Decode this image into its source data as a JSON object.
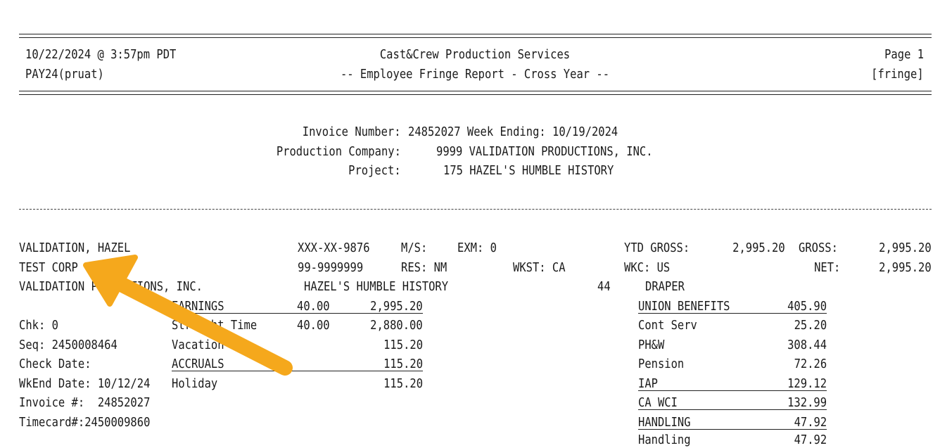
{
  "header": {
    "datetime": "10/22/2024 @ 3:57pm PDT",
    "user": "PAY24(pruat)",
    "company": "Cast&Crew Production Services",
    "report_title": "-- Employee Fringe Report - Cross Year --",
    "page": "Page 1",
    "code": "[fringe]"
  },
  "invoice": {
    "invoice_label": "Invoice Number:",
    "invoice_value": "24852027 Week Ending: 10/19/2024",
    "company_label": "Production Company:",
    "company_value": "9999 VALIDATION PRODUCTIONS, INC.",
    "project_label": "Project:",
    "project_value": "175 HAZEL'S HUMBLE HISTORY"
  },
  "employee": {
    "name": "VALIDATION, HAZEL",
    "corp": "TEST CORP",
    "production": "VALIDATION PRODUCTIONS, INC.",
    "ssn": "XXX-XX-9876",
    "ms": "M/S:",
    "exm": "EXM: 0",
    "fein": "99-9999999",
    "res": "RES: NM",
    "wkst": "WKST: CA",
    "project": "HAZEL'S HUMBLE HISTORY",
    "occ_num": "44",
    "occupation": "DRAPER",
    "ytd_gross_label": "YTD GROSS:",
    "ytd_gross_value": "2,995.20",
    "gross_label": "GROSS:",
    "gross_value": "2,995.20",
    "wkc": "WKC: US",
    "net_label": "NET:",
    "net_value": "2,995.20"
  },
  "check": {
    "chk": "Chk: 0",
    "seq": "Seq: 2450008464",
    "check_date": "Check Date:",
    "wkend": "WkEnd Date: 10/12/24",
    "invoice": "Invoice #:  24852027",
    "timecard": "Timecard#:2450009860"
  },
  "earnings": [
    {
      "label": "EARNINGS",
      "hours": "40.00",
      "amount": "2,995.20",
      "underline": true
    },
    {
      "label": "Straight Time",
      "hours": "40.00",
      "amount": "2,880.00",
      "underline": false
    },
    {
      "label": "Vacation",
      "hours": "",
      "amount": "115.20",
      "underline": false
    },
    {
      "label": "ACCRUALS",
      "hours": "",
      "amount": "115.20",
      "underline": true
    },
    {
      "label": "Holiday",
      "hours": "",
      "amount": "115.20",
      "underline": false
    }
  ],
  "benefits": [
    {
      "label": "UNION BENEFITS",
      "amount": "405.90",
      "underline": true
    },
    {
      "label": "Cont Serv",
      "amount": "25.20",
      "underline": false
    },
    {
      "label": "PH&W",
      "amount": "308.44",
      "underline": false
    },
    {
      "label": "Pension",
      "amount": "72.26",
      "underline": false
    },
    {
      "label": "IAP",
      "amount": "129.12",
      "underline": true
    },
    {
      "label": "CA WCI",
      "amount": "132.99",
      "underline": true
    },
    {
      "label": "HANDLING",
      "amount": "47.92",
      "underline": true
    },
    {
      "label": "Handling",
      "amount": "47.92",
      "underline": false
    }
  ],
  "colors": {
    "arrow": "#f5a81c"
  }
}
